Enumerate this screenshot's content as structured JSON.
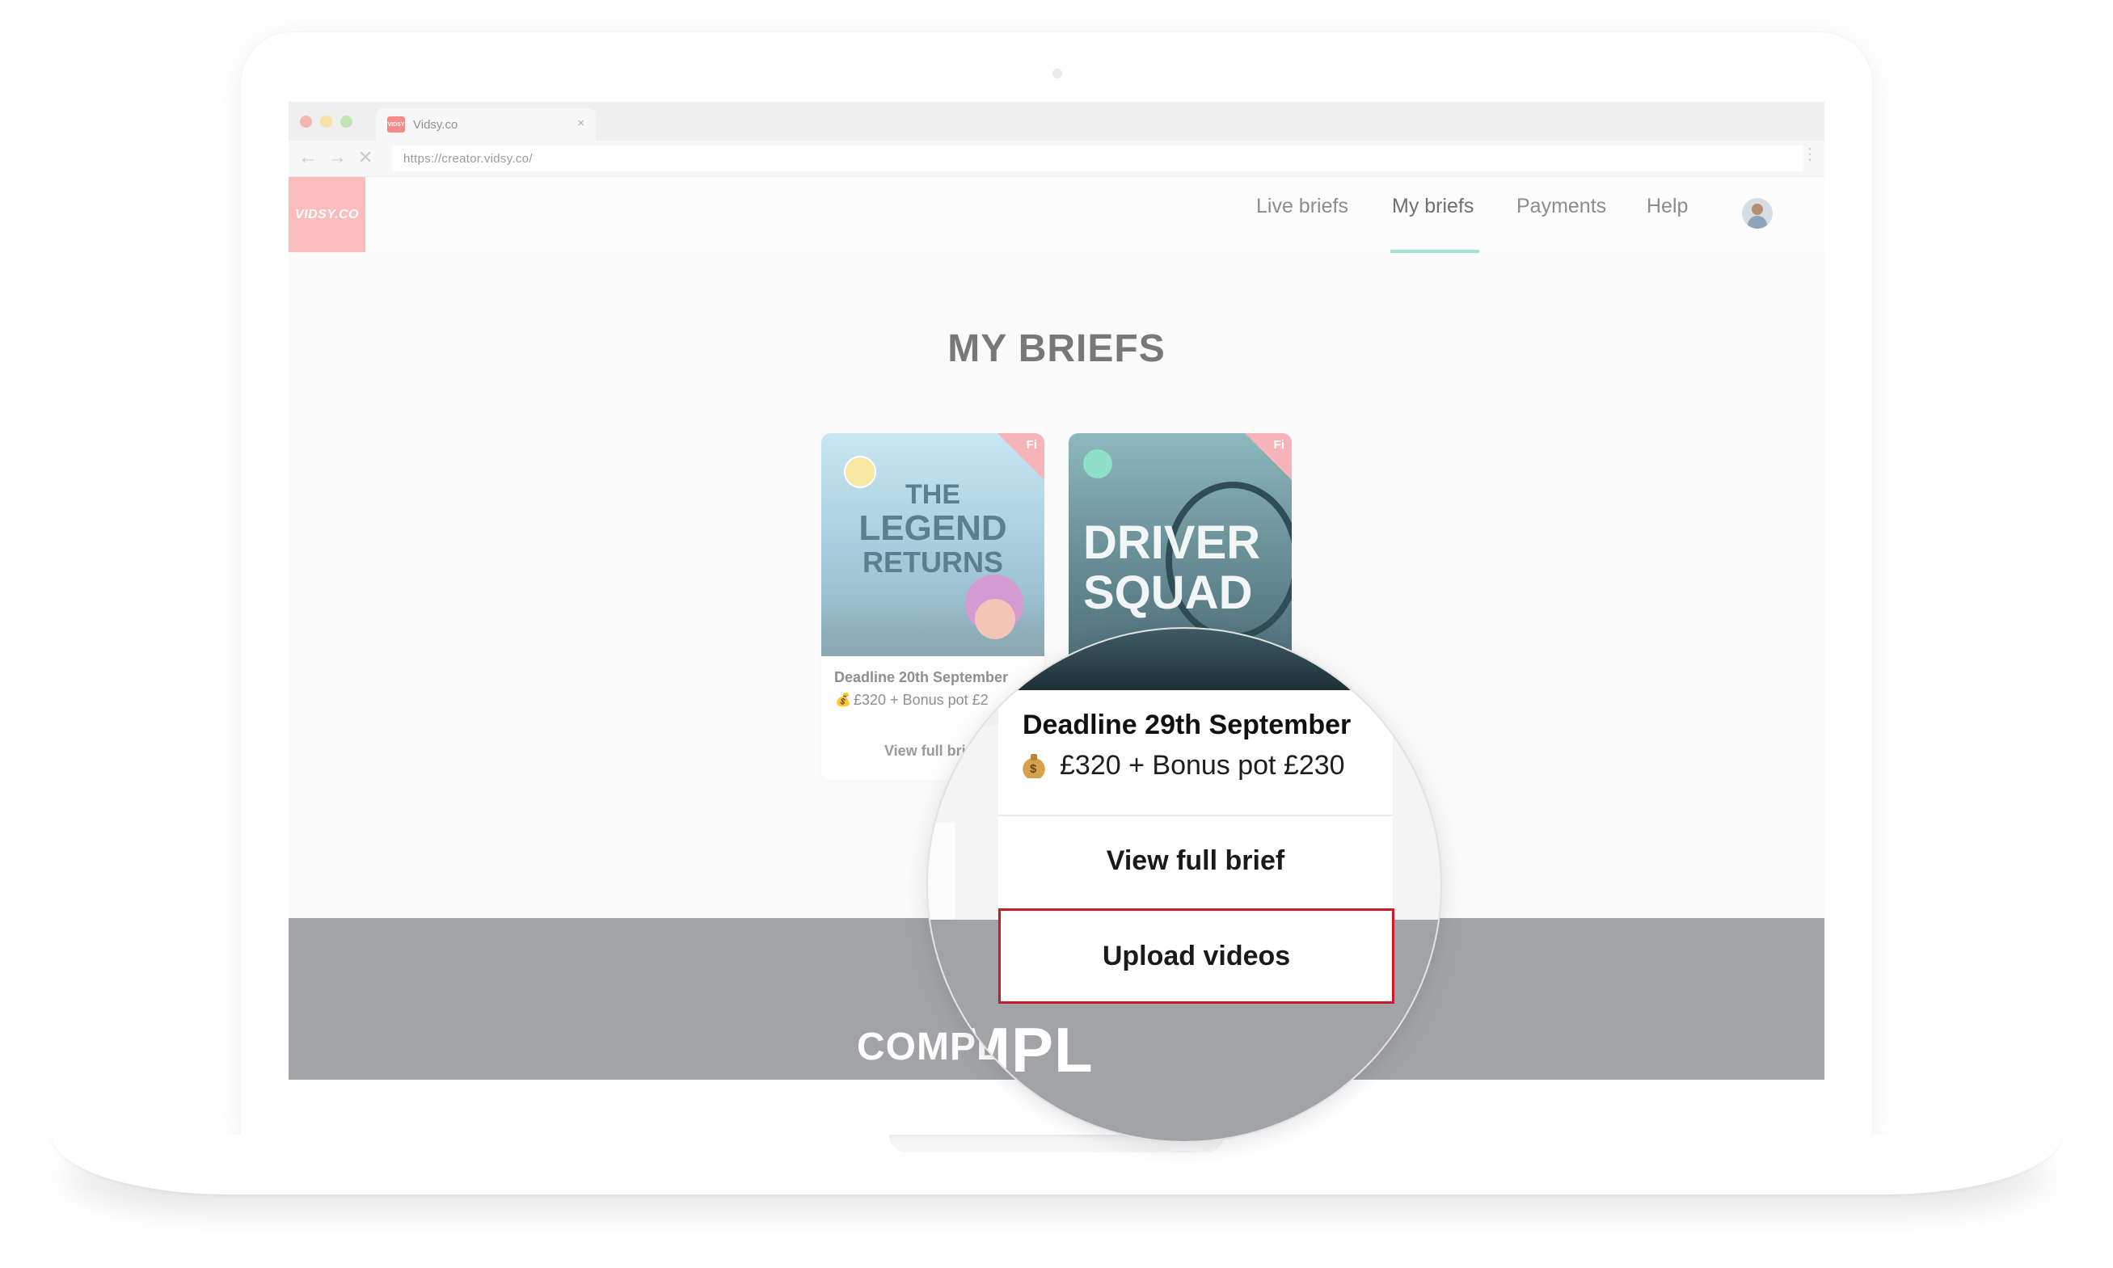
{
  "browser": {
    "tab_title": "Vidsy.co",
    "tab_favicon_text": "VIDSY",
    "tab_close": "×",
    "url": "https://creator.vidsy.co/",
    "back_glyph": "←",
    "forward_glyph": "→",
    "stop_glyph": "✕",
    "menu_glyph": "⋮"
  },
  "header": {
    "logo_text": "VIDSY.CO",
    "nav": [
      "Live briefs",
      "My briefs",
      "Payments",
      "Help"
    ],
    "active_nav": "My briefs"
  },
  "page": {
    "title": "MY BRIEFS"
  },
  "cards": [
    {
      "corner_label": "Fi",
      "thumb_text_lines": [
        "THE",
        "LEGEND",
        "RETURNS"
      ],
      "deadline": "Deadline 20th September",
      "price": "£320 + Bonus pot £2",
      "view_label": "View full bri"
    },
    {
      "corner_label": "Fi",
      "thumb_text_lines": [
        "DRIVER",
        "SQUAD"
      ]
    }
  ],
  "footer": {
    "text": "COMPL"
  },
  "magnifier": {
    "deadline": "Deadline 29th September",
    "price": "£320 + Bonus pot £230",
    "bag_sign": "$",
    "view_label": "View full brief",
    "upload_label": "Upload videos",
    "footer_text": "COMPL"
  },
  "colors": {
    "accent_underline": "#9fe5d6",
    "logo_bg": "#fbbcbc",
    "highlight_border": "#c41d2c",
    "footer_band": "#a1a3a6"
  }
}
